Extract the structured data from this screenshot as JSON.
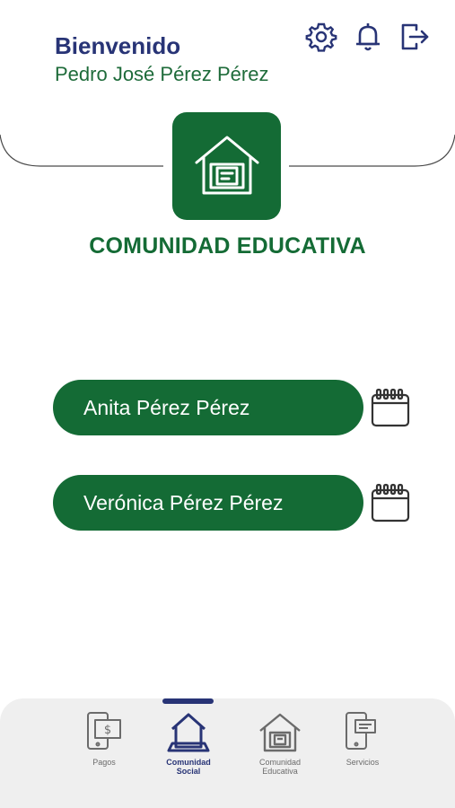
{
  "header": {
    "welcome": "Bienvenido",
    "user_name": "Pedro José Pérez Pérez",
    "icons": [
      "gear-icon",
      "bell-icon",
      "logout-icon"
    ]
  },
  "module": {
    "icon": "school-house-icon",
    "title": "COMUNIDAD EDUCATIVA"
  },
  "students": [
    {
      "name": "Anita Pérez Pérez",
      "action_icon": "calendar-icon"
    },
    {
      "name": "Verónica Pérez Pérez",
      "action_icon": "calendar-icon"
    }
  ],
  "bottom_nav": {
    "active": "Comunidad Social",
    "items": [
      {
        "label": "Pagos",
        "icon": "payment-phone-icon"
      },
      {
        "label_line1": "Comunidad",
        "label_line2": "Social",
        "icon": "community-social-icon"
      },
      {
        "label_line1": "Comunidad",
        "label_line2": "Educativa",
        "icon": "school-house-icon"
      },
      {
        "label": "Servicios",
        "icon": "services-phone-icon"
      }
    ]
  },
  "colors": {
    "primary_green": "#146b35",
    "navy": "#283476",
    "nav_bg": "#efefef"
  }
}
